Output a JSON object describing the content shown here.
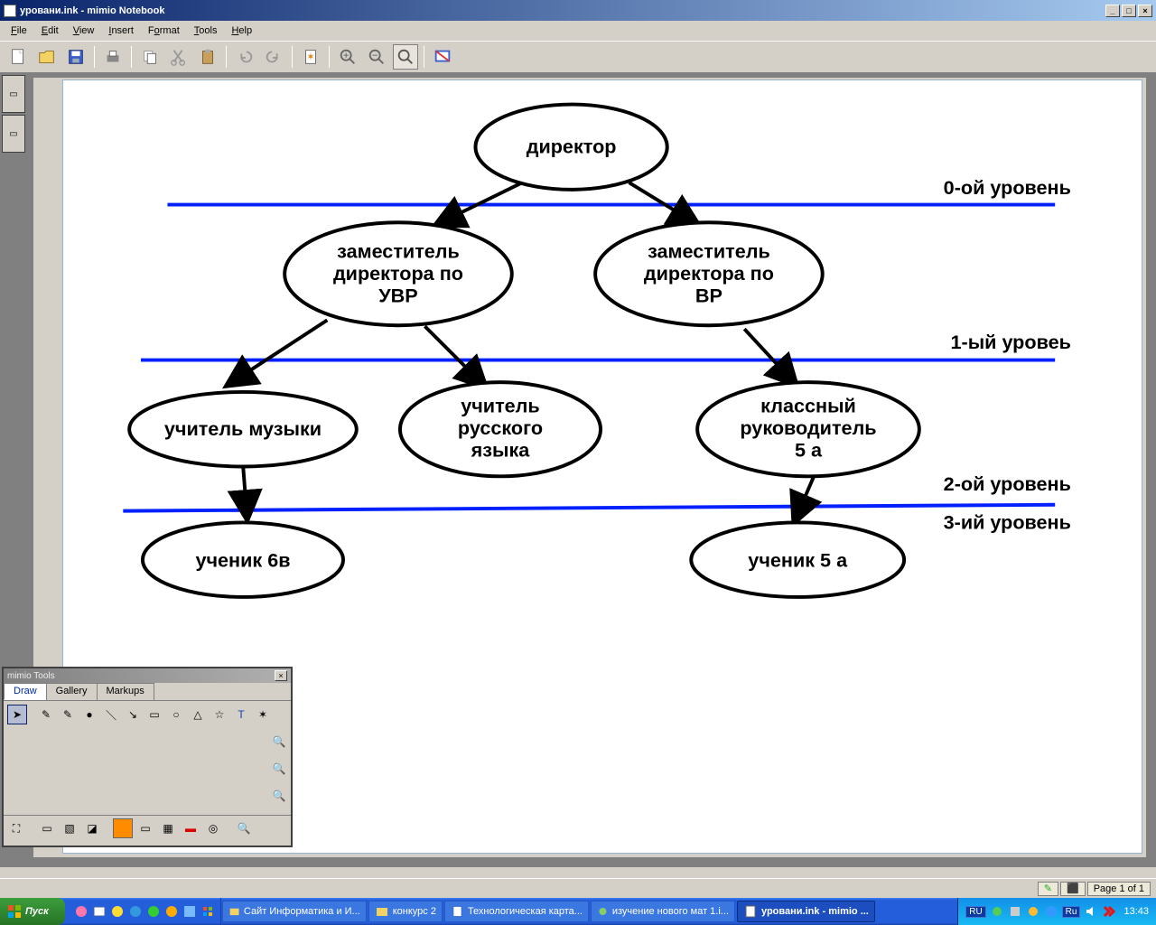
{
  "window": {
    "title": "уровани.ink - mimio Notebook"
  },
  "menu": {
    "file": "File",
    "edit": "Edit",
    "view": "View",
    "insert": "Insert",
    "format": "Format",
    "tools": "Tools",
    "help": "Help"
  },
  "diagram": {
    "nodes": {
      "director": "директор",
      "deputy_uvr_l1": "заместитель",
      "deputy_uvr_l2": "директора по",
      "deputy_uvr_l3": "УВР",
      "deputy_vr_l1": "заместитель",
      "deputy_vr_l2": "директора по",
      "deputy_vr_l3": "ВР",
      "music": "учитель музыки",
      "russian_l1": "учитель",
      "russian_l2": "русского",
      "russian_l3": "языка",
      "classr_l1": "классный",
      "classr_l2": "руководитель",
      "classr_l3": "5 а",
      "student6v": "ученик 6в",
      "student5a": "ученик 5 а"
    },
    "levels": {
      "l0": "0-ой уровень",
      "l1": "1-ый уровеь",
      "l2": "2-ой уровень",
      "l3": "3-ий уровень"
    }
  },
  "tools_window": {
    "title": "mimio Tools",
    "tabs": {
      "draw": "Draw",
      "gallery": "Gallery",
      "markups": "Markups"
    }
  },
  "statusbar": {
    "page": "Page 1 of 1"
  },
  "taskbar": {
    "start": "Пуск",
    "items": {
      "t1": "Сайт Информатика и И...",
      "t2": "конкурс 2",
      "t3": "Технологическая карта...",
      "t4": "изучение нового мат 1.i...",
      "t5": "уровани.ink - mimio ..."
    },
    "lang1": "RU",
    "lang2": "Ru",
    "clock": "13:43"
  }
}
